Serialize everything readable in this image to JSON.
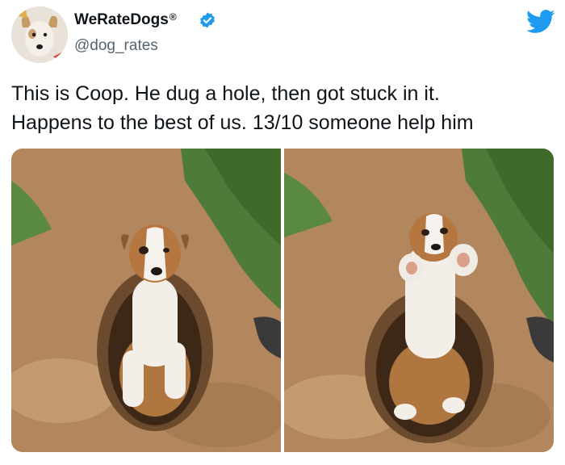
{
  "header": {
    "display_name": "WeRateDogs",
    "registered_mark": "®",
    "handle": "@dog_rates",
    "avatar_icon": "dog-avatar",
    "verified_icon": "verified-badge-icon",
    "logo_icon": "twitter-bird-icon"
  },
  "tweet": {
    "line1": "This is Coop. He dug a hole, then got stuck in it.",
    "line2": "Happens to the best of us. 13/10 someone help him"
  },
  "media": {
    "count": 2
  },
  "colors": {
    "twitter_blue": "#1d9bf0",
    "text_primary": "#0f1419",
    "text_secondary": "#536471",
    "dirt": "#b0845c",
    "grass": "#4f7b3a"
  }
}
